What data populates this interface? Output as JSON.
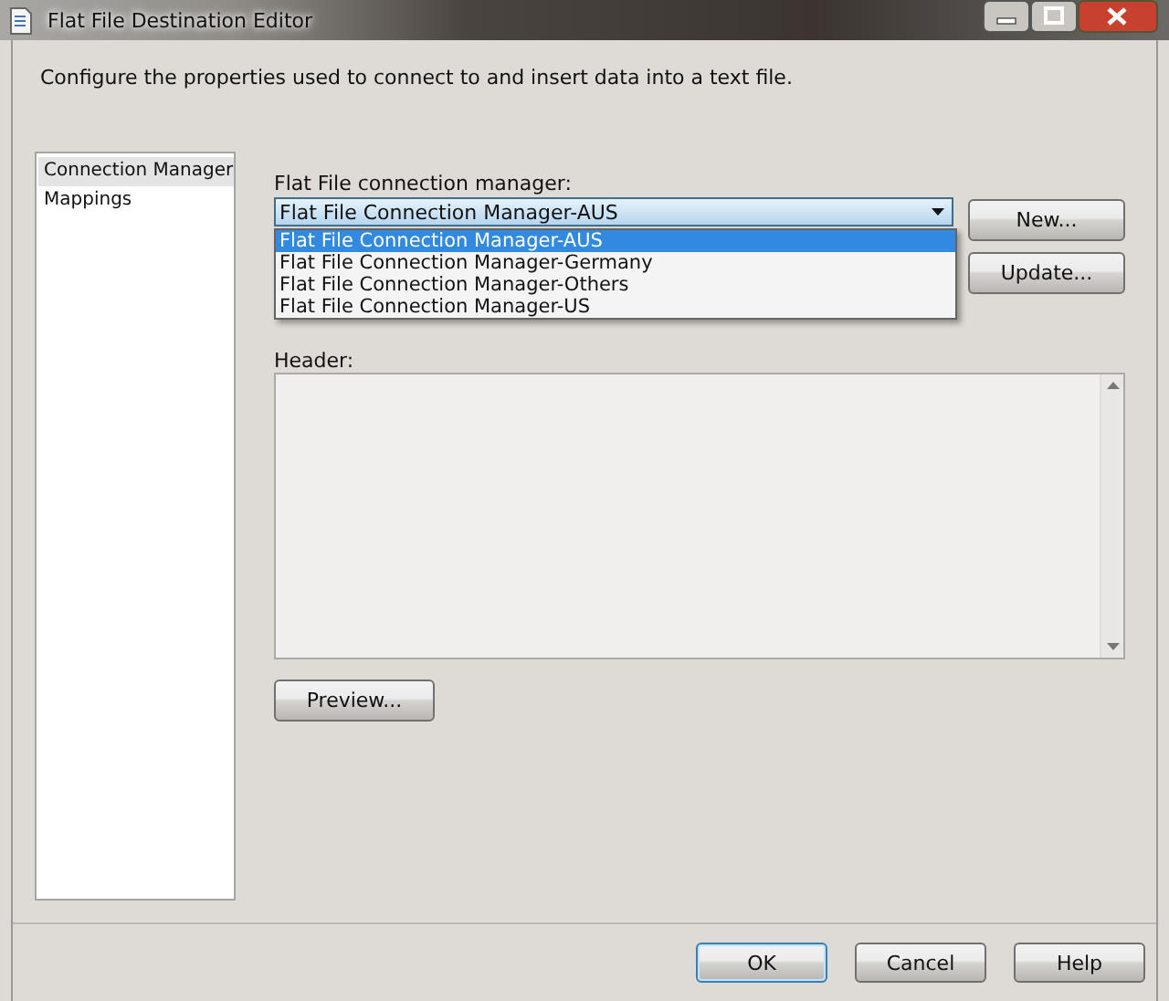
{
  "window": {
    "title": "Flat File Destination Editor"
  },
  "description": "Configure the properties used to connect to and insert data into a text file.",
  "sidebar": {
    "items": [
      {
        "label": "Connection Manager",
        "selected": true
      },
      {
        "label": "Mappings",
        "selected": false
      }
    ]
  },
  "connection_manager": {
    "label": "Flat File connection manager:",
    "value": "Flat File Connection Manager-AUS",
    "expanded": true,
    "options": [
      {
        "label": "Flat File Connection Manager-AUS",
        "selected": true
      },
      {
        "label": "Flat File Connection Manager-Germany",
        "selected": false
      },
      {
        "label": "Flat File Connection Manager-Others",
        "selected": false
      },
      {
        "label": "Flat File Connection Manager-US",
        "selected": false
      }
    ]
  },
  "side_buttons": [
    "New...",
    "Update..."
  ],
  "header": {
    "label": "Header:"
  },
  "preview_button": "Preview...",
  "footer_buttons": [
    {
      "label": "OK",
      "default": true
    },
    {
      "label": "Cancel",
      "default": false
    },
    {
      "label": "Help",
      "default": false
    }
  ]
}
